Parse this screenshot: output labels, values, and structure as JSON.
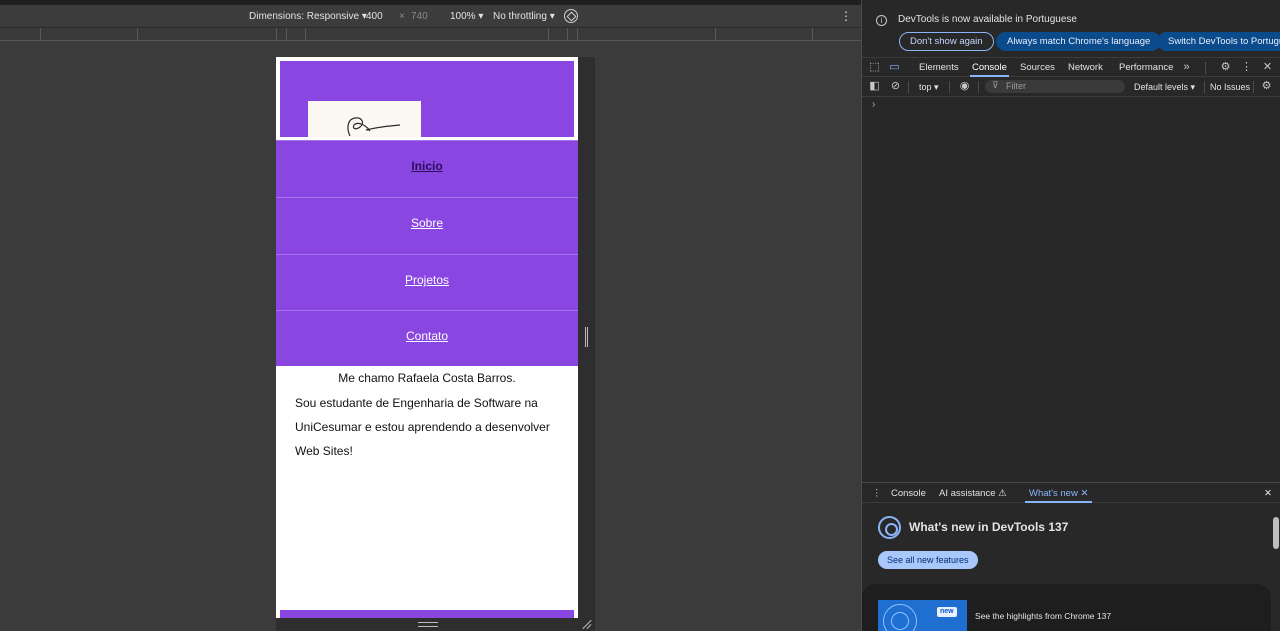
{
  "emulator": {
    "dimensions_label": "Dimensions: Responsive ▾",
    "width_value": "400",
    "times": "×",
    "height_value": "740",
    "zoom": "100% ▾",
    "throttling": "No throttling ▾"
  },
  "site": {
    "nav_items": [
      "Inicio",
      "Sobre",
      "Projetos",
      "Contato"
    ],
    "intro": "Me chamo Rafaela Costa Barros.",
    "bio": "Sou estudante de Engenharia de Software na UniCesumar e estou aprendendo a desenvolver Web Sites!",
    "accent_color": "#8a46e0"
  },
  "devtools": {
    "info_message": "DevTools is now available in Portuguese",
    "info_buttons": [
      "Don't show again",
      "Always match Chrome's language",
      "Switch DevTools to Portuguese"
    ],
    "tabs": [
      "Elements",
      "Console",
      "Sources",
      "Network",
      "Performance"
    ],
    "active_tab": "Console",
    "console_context": "top ▾",
    "filter_placeholder": "Filter",
    "default_levels": "Default levels ▾",
    "issues": "No Issues",
    "prompt": "›",
    "drawer": {
      "tabs": [
        "Console",
        "AI assistance ⚠",
        "What's new ✕"
      ],
      "active_tab": "What's new",
      "title": "What's new in DevTools 137",
      "see_all": "See all new features",
      "card_badge": "new",
      "card_text": "See the highlights from Chrome 137"
    }
  }
}
